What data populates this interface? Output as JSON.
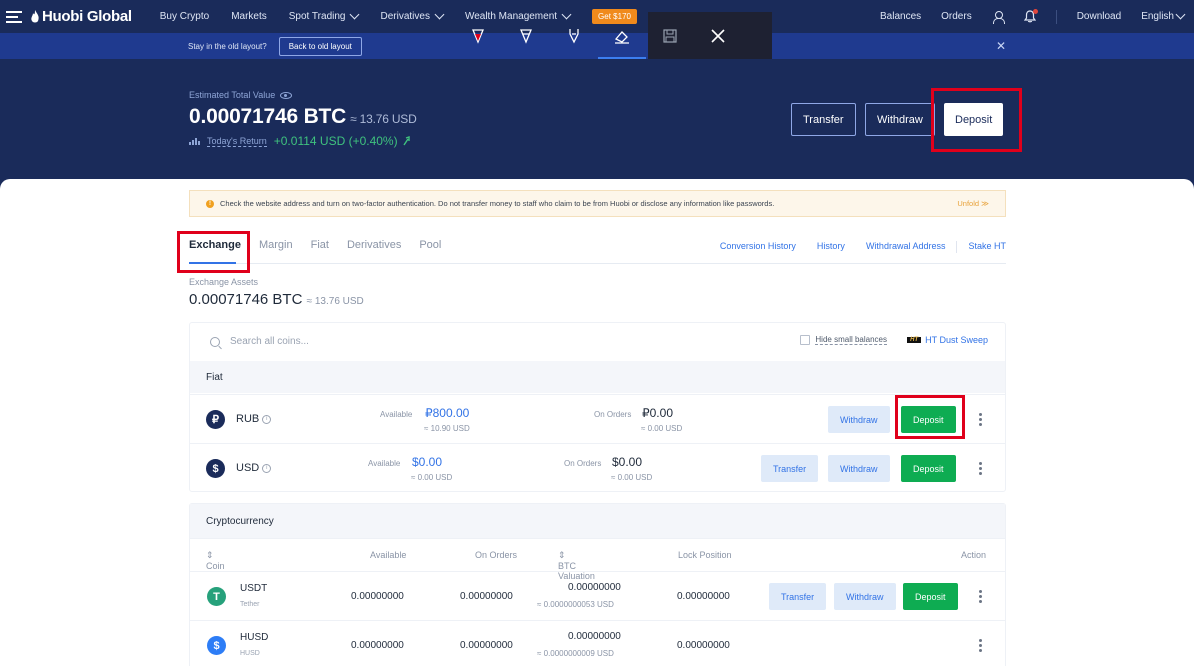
{
  "nav": {
    "brand": "Huobi Global",
    "items": [
      "Buy Crypto",
      "Markets",
      "Spot Trading",
      "Derivatives",
      "Wealth Management"
    ],
    "promo": "Get $170",
    "right": [
      "Balances",
      "Orders",
      "Download",
      "English"
    ]
  },
  "oldlayout": {
    "text": "Stay in the old layout?",
    "button": "Back to old layout"
  },
  "hero": {
    "est_label": "Estimated Total Value",
    "est_value": "0.00071746 BTC",
    "est_usd": "≈ 13.76 USD",
    "today_label": "Today's Return",
    "today_value": "+0.0114 USD (+0.40%)",
    "buttons": {
      "transfer": "Transfer",
      "withdraw": "Withdraw",
      "deposit": "Deposit"
    }
  },
  "notice": {
    "text": "Check the website address and turn on two-factor authentication. Do not transfer money to staff who claim to be from Huobi or disclose any information like passwords.",
    "unfold": "Unfold"
  },
  "tabs": [
    "Exchange",
    "Margin",
    "Fiat",
    "Derivatives",
    "Pool"
  ],
  "links": [
    "Conversion History",
    "History",
    "Withdrawal Address",
    "Stake HT"
  ],
  "exchange": {
    "label": "Exchange Assets",
    "value": "0.00071746 BTC",
    "usd": "≈ 13.76 USD"
  },
  "search": {
    "placeholder": "Search all coins...",
    "hide_small": "Hide small balances",
    "dust_badge": "HT",
    "dust": "HT Dust Sweep"
  },
  "fiat": {
    "title": "Fiat",
    "rows": [
      {
        "coin": "RUB",
        "symbol": "₽",
        "available_label": "Available",
        "available": "₽800.00",
        "available_usd": "≈ 10.90 USD",
        "orders_label": "On Orders",
        "orders": "₽0.00",
        "orders_usd": "≈ 0.00 USD",
        "withdraw": "Withdraw",
        "deposit": "Deposit"
      },
      {
        "coin": "USD",
        "symbol": "$",
        "available_label": "Available",
        "available": "$0.00",
        "available_usd": "≈ 0.00 USD",
        "orders_label": "On Orders",
        "orders": "$0.00",
        "orders_usd": "≈ 0.00 USD",
        "transfer": "Transfer",
        "withdraw": "Withdraw",
        "deposit": "Deposit"
      }
    ]
  },
  "crypto": {
    "title": "Cryptocurrency",
    "columns": [
      "Coin",
      "Available",
      "On Orders",
      "BTC Valuation",
      "Lock Position",
      "Action"
    ],
    "rows": [
      {
        "coin": "USDT",
        "name": "Tether",
        "available": "0.00000000",
        "orders": "0.00000000",
        "btc": "0.00000000",
        "btc_usd": "≈ 0.0000000053 USD",
        "lock": "0.00000000",
        "transfer": "Transfer",
        "withdraw": "Withdraw",
        "deposit": "Deposit"
      },
      {
        "coin": "HUSD",
        "name": "HUSD",
        "available": "0.00000000",
        "orders": "0.00000000",
        "btc": "0.00000000",
        "btc_usd": "≈ 0.0000000009 USD",
        "lock": "0.00000000"
      }
    ]
  },
  "colors": {
    "nav": "#1a2b5a",
    "accent": "#3273e6",
    "green": "#0eac52",
    "highlight": "#e0001b"
  }
}
